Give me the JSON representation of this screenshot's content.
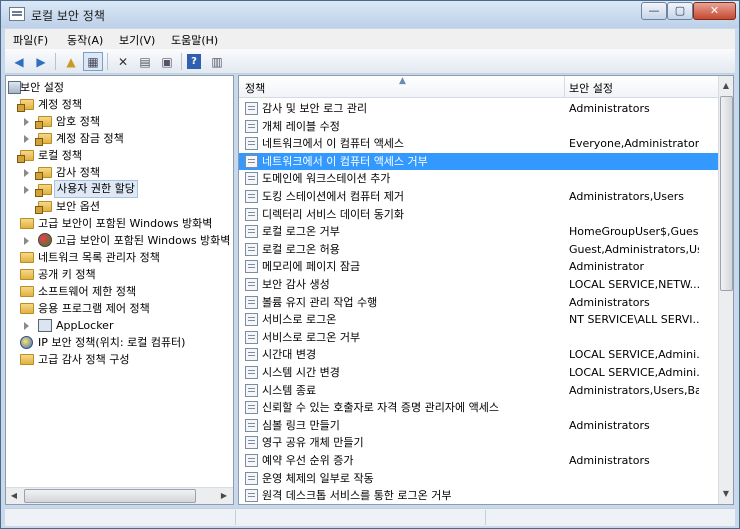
{
  "window": {
    "title": "로컬 보안 정책",
    "controls": {
      "minimize": "—",
      "maximize": "▢",
      "close": "✕"
    }
  },
  "menubar": {
    "items": [
      "파일(F)",
      "동작(A)",
      "보기(V)",
      "도움말(H)"
    ]
  },
  "toolbar": {
    "buttons": [
      "back-icon",
      "forward-icon",
      "up-folder-icon",
      "show-tree-icon",
      "delete-icon",
      "properties-icon",
      "export-icon",
      "help-icon",
      "console-icon"
    ]
  },
  "tree": {
    "root": "보안 설정",
    "items": [
      {
        "label": "계정 정책",
        "level": 1,
        "expanded": true
      },
      {
        "label": "암호 정책",
        "level": 2
      },
      {
        "label": "계정 잠금 정책",
        "level": 2
      },
      {
        "label": "로컬 정책",
        "level": 1,
        "expanded": true
      },
      {
        "label": "감사 정책",
        "level": 2
      },
      {
        "label": "사용자 권한 할당",
        "level": 2,
        "selected": true
      },
      {
        "label": "보안 옵션",
        "level": 2
      },
      {
        "label": "고급 보안이 포함된 Windows 방화벽",
        "level": 1
      },
      {
        "label": "고급 보안이 포함된 Windows 방화벽",
        "level": 2
      },
      {
        "label": "네트워크 목록 관리자 정책",
        "level": 1
      },
      {
        "label": "공개 키 정책",
        "level": 1
      },
      {
        "label": "소프트웨어 제한 정책",
        "level": 1
      },
      {
        "label": "응용 프로그램 제어 정책",
        "level": 1
      },
      {
        "label": "AppLocker",
        "level": 2
      },
      {
        "label": "IP 보안 정책(위치: 로컬 컴퓨터)",
        "level": 1
      },
      {
        "label": "고급 감사 정책 구성",
        "level": 1
      }
    ]
  },
  "list": {
    "columns": [
      "정책",
      "보안 설정"
    ],
    "rows": [
      {
        "policy": "감사 및 보안 로그 관리",
        "setting": "Administrators"
      },
      {
        "policy": "개체 레이블 수정",
        "setting": ""
      },
      {
        "policy": "네트워크에서 이 컴퓨터 액세스",
        "setting": "Everyone,Administrators..."
      },
      {
        "policy": "네트워크에서 이 컴퓨터 액세스 거부",
        "setting": "",
        "selected": true
      },
      {
        "policy": "도메인에 워크스테이션 추가",
        "setting": ""
      },
      {
        "policy": "도킹 스테이션에서 컴퓨터 제거",
        "setting": "Administrators,Users"
      },
      {
        "policy": "디렉터리 서비스 데이터 동기화",
        "setting": ""
      },
      {
        "policy": "로컬 로그온 거부",
        "setting": "HomeGroupUser$,Guest"
      },
      {
        "policy": "로컬 로그온 허용",
        "setting": "Guest,Administrators,Us..."
      },
      {
        "policy": "메모리에 페이지 잠금",
        "setting": "Administrator"
      },
      {
        "policy": "보안 감사 생성",
        "setting": "LOCAL SERVICE,NETW..."
      },
      {
        "policy": "볼륨 유지 관리 작업 수행",
        "setting": "Administrators"
      },
      {
        "policy": "서비스로 로그온",
        "setting": "NT SERVICE\\ALL SERVI..."
      },
      {
        "policy": "서비스로 로그온 거부",
        "setting": ""
      },
      {
        "policy": "시간대 변경",
        "setting": "LOCAL SERVICE,Admini..."
      },
      {
        "policy": "시스템 시간 변경",
        "setting": "LOCAL SERVICE,Admini..."
      },
      {
        "policy": "시스템 종료",
        "setting": "Administrators,Users,Ba..."
      },
      {
        "policy": "신뢰할 수 있는 호출자로 자격 증명 관리자에 액세스",
        "setting": ""
      },
      {
        "policy": "심볼 링크 만들기",
        "setting": "Administrators"
      },
      {
        "policy": "영구 공유 개체 만들기",
        "setting": ""
      },
      {
        "policy": "예약 우선 순위 증가",
        "setting": "Administrators"
      },
      {
        "policy": "운영 체제의 일부로 작동",
        "setting": ""
      },
      {
        "policy": "원격 데스크톱 서비스를 통한 로그온 거부",
        "setting": ""
      }
    ]
  },
  "colors": {
    "selection": "#3399ff",
    "frame": "#c9d8eb"
  }
}
